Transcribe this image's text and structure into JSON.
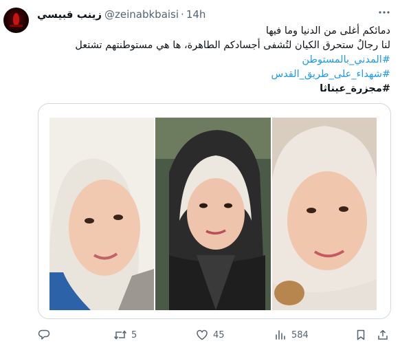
{
  "tweet": {
    "display_name": "زينب قبيسي",
    "handle": "@zeinabkbaisi",
    "separator": "·",
    "time": "14h",
    "lines": [
      "دمائكم أغلى من الدنيا وما فيها",
      "لنا رجالٌ ستحرق الكيان لتُشفى أجسادكم الطاهرة، ها هي مستوطنتهم تشتعل"
    ],
    "hashtags": [
      "#المدني_بالمستوطن",
      "#شهداء_على_طريق_القدس",
      "#مجزرة_عيناثا"
    ]
  },
  "icons": {
    "more": "more-horizontal-icon",
    "reply": "reply-icon",
    "retweet": "retweet-icon",
    "like": "heart-icon",
    "views": "views-bar-chart-icon",
    "bookmark": "bookmark-icon",
    "share": "share-icon"
  },
  "actions": {
    "replies": "",
    "retweets": "5",
    "likes": "45",
    "views": "584"
  },
  "colors": {
    "text": "#0f1419",
    "secondary": "#536471",
    "link": "#1d9bf0",
    "border": "#cfd9de"
  }
}
